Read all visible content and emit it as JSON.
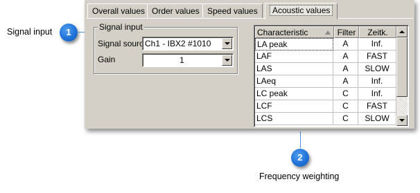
{
  "callouts": {
    "signal_input": {
      "number": "1",
      "label": "Signal input"
    },
    "frequency_weighting": {
      "number": "2",
      "label": "Frequency weighting"
    }
  },
  "tabs": [
    {
      "label": "Overall values"
    },
    {
      "label": "Order values"
    },
    {
      "label": "Speed values"
    },
    {
      "label": "Acoustic values",
      "active": true
    }
  ],
  "signal_input": {
    "group_title": "Signal input",
    "source_label": "Signal source",
    "source_value": "Ch1 - IBX2 #1010",
    "gain_label": "Gain",
    "gain_value": "1"
  },
  "table": {
    "columns": [
      "Characteristic",
      "Filter",
      "Zeitk."
    ],
    "rows": [
      {
        "characteristic": "LA peak",
        "filter": "A",
        "zeitk": "Inf."
      },
      {
        "characteristic": "LAF",
        "filter": "A",
        "zeitk": "FAST"
      },
      {
        "characteristic": "LAS",
        "filter": "A",
        "zeitk": "SLOW"
      },
      {
        "characteristic": "LAeq",
        "filter": "A",
        "zeitk": "Inf."
      },
      {
        "characteristic": "LC peak",
        "filter": "C",
        "zeitk": "Inf."
      },
      {
        "characteristic": "LCF",
        "filter": "C",
        "zeitk": "FAST"
      },
      {
        "characteristic": "LCS",
        "filter": "C",
        "zeitk": "SLOW"
      }
    ]
  },
  "colors": {
    "callout_badge": "#1d6fd6",
    "leader_line": "#4a90e2",
    "panel_bg": "#d4d0c8"
  }
}
